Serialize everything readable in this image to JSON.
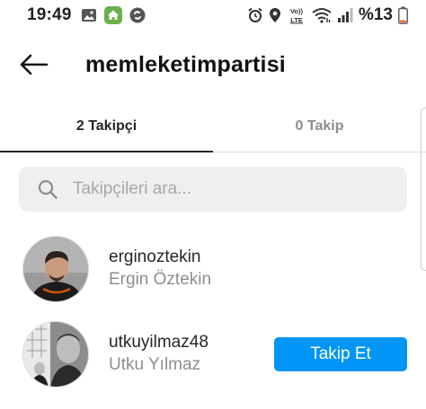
{
  "status_bar": {
    "time": "19:49",
    "battery": "%13",
    "left_icons": [
      "image-icon",
      "home-app-icon",
      "shazam-icon"
    ],
    "right_icons": [
      "alarm-icon",
      "location-icon",
      "volte-icon",
      "wifi-icon",
      "signal-icon",
      "battery-icon"
    ],
    "volte_label": "Vo)) LTE"
  },
  "header": {
    "title": "memleketimpartisi"
  },
  "tabs": [
    {
      "label": "2 Takipçi",
      "active": true
    },
    {
      "label": "0 Takip",
      "active": false
    }
  ],
  "search": {
    "placeholder": "Takipçileri ara...",
    "value": ""
  },
  "followers": [
    {
      "username": "erginoztekin",
      "full_name": "Ergin Öztekin",
      "button": ""
    },
    {
      "username": "utkuyilmaz48",
      "full_name": "Utku Yılmaz",
      "button": "Takip Et"
    }
  ],
  "colors": {
    "accent": "#0095f6",
    "text_primary": "#262626",
    "text_secondary": "#8e8e8e",
    "search_bg": "#efefef",
    "battery_low": "#e8793a"
  }
}
